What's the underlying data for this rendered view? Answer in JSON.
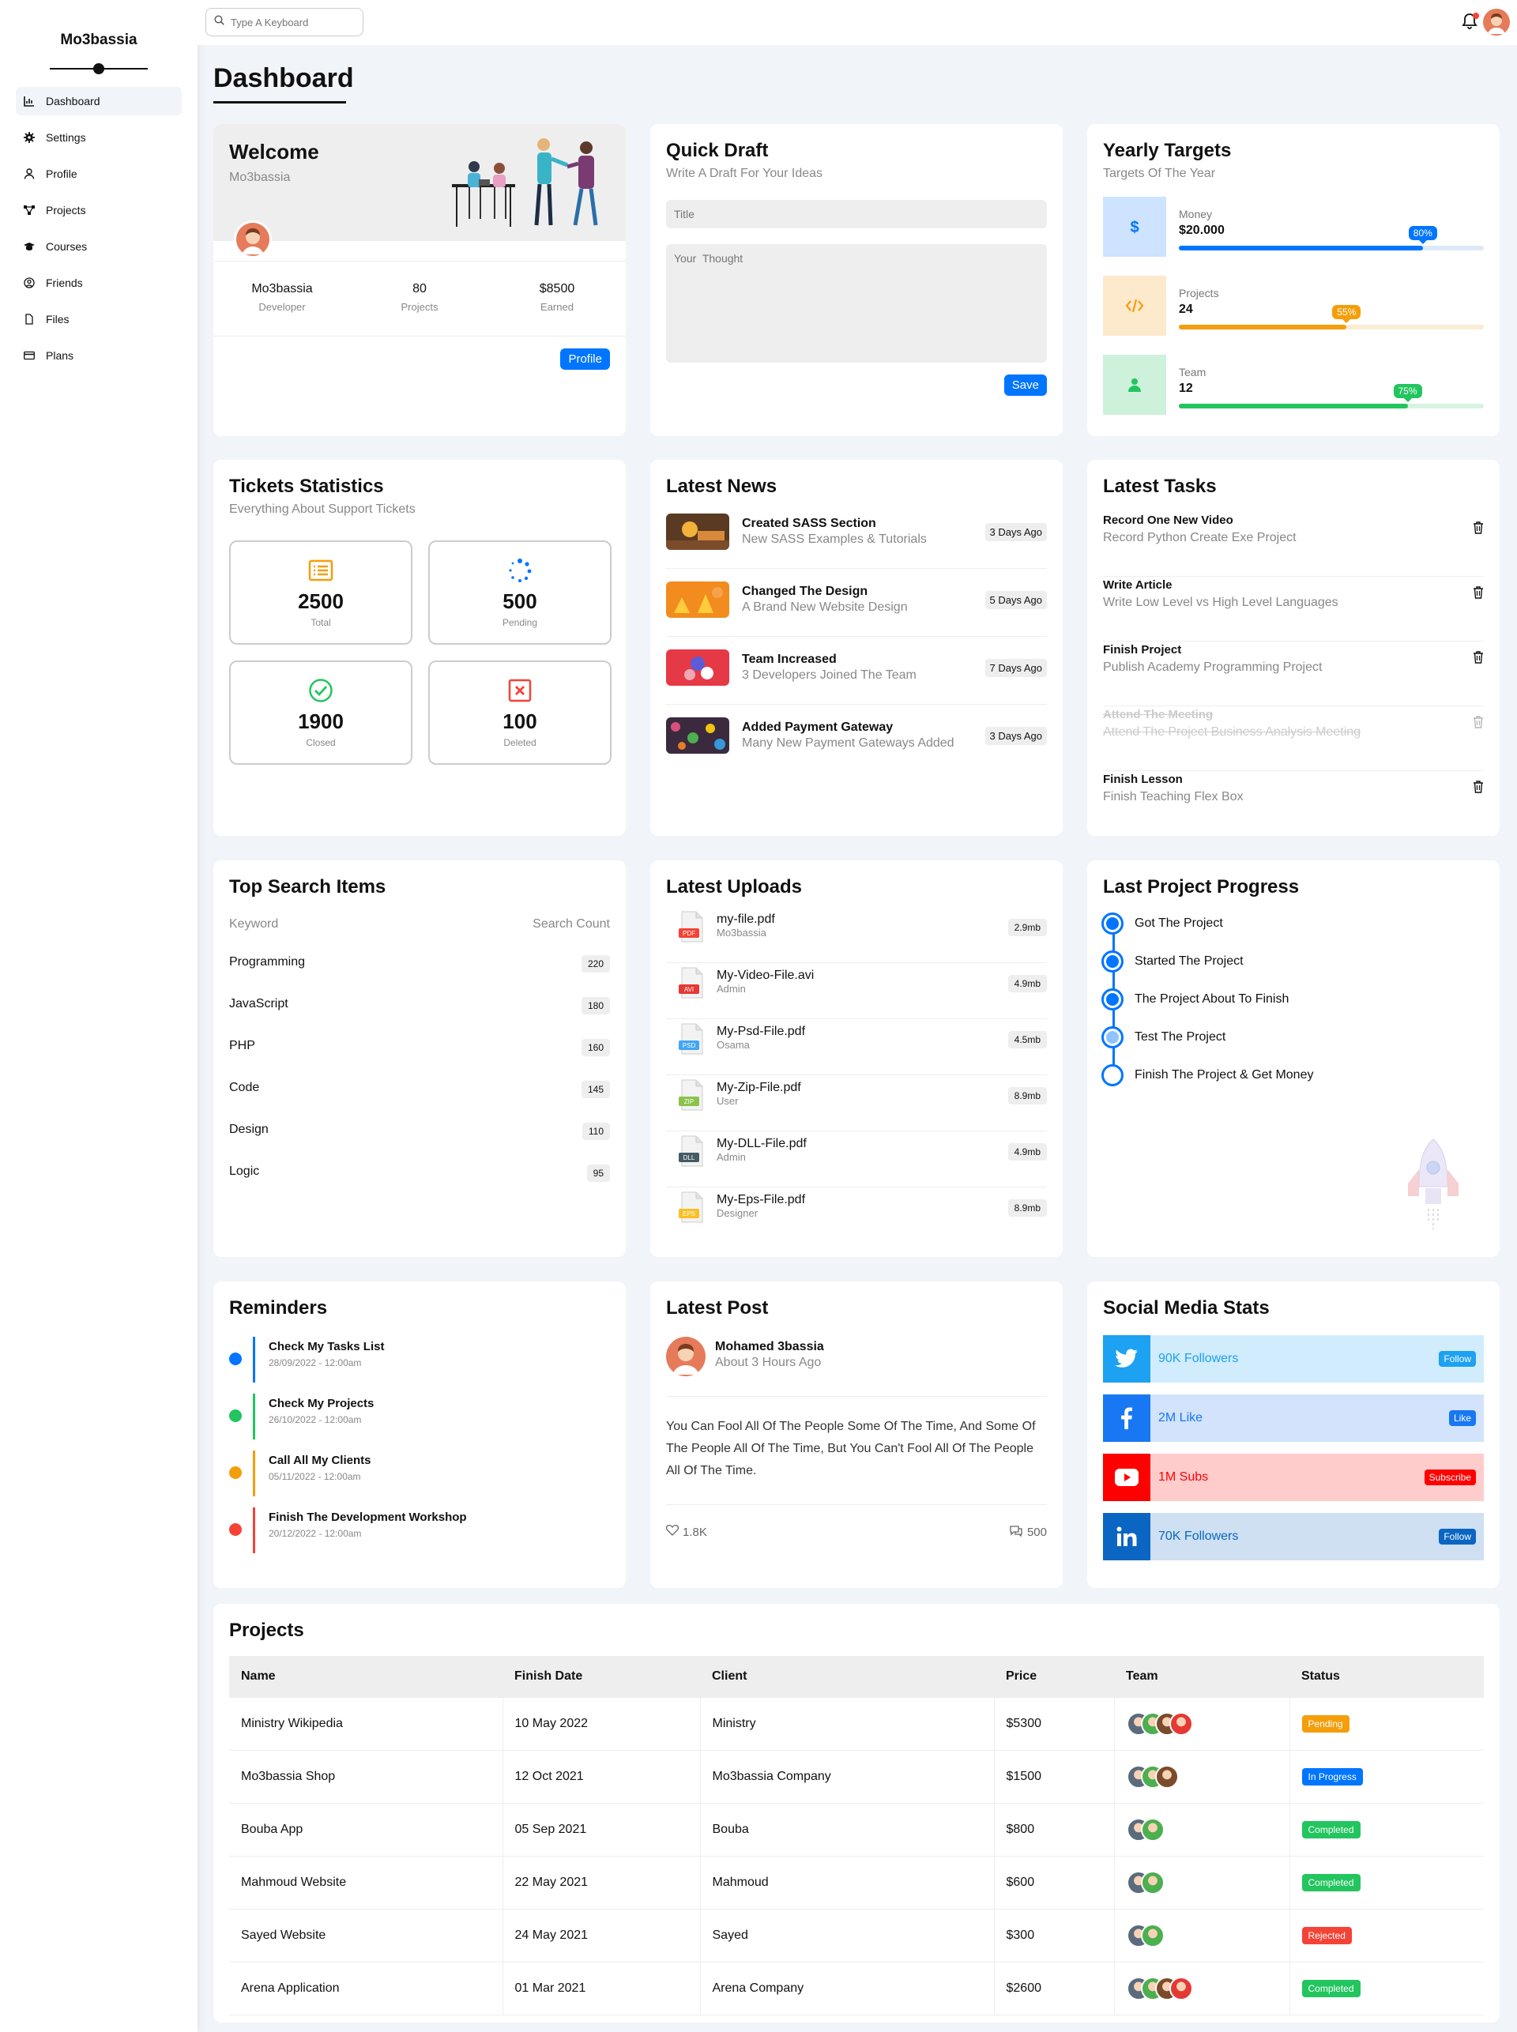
{
  "brand": "Mo3bassia",
  "sidebar": {
    "items": [
      {
        "label": "Dashboard",
        "icon": "chart-icon"
      },
      {
        "label": "Settings",
        "icon": "gear-icon"
      },
      {
        "label": "Profile",
        "icon": "user-icon"
      },
      {
        "label": "Projects",
        "icon": "diagram-icon"
      },
      {
        "label": "Courses",
        "icon": "graduation-cap-icon"
      },
      {
        "label": "Friends",
        "icon": "user-circle-icon"
      },
      {
        "label": "Files",
        "icon": "file-icon"
      },
      {
        "label": "Plans",
        "icon": "credit-card-icon"
      }
    ]
  },
  "header": {
    "search_placeholder": "Type A Keyboard"
  },
  "page_title": "Dashboard",
  "welcome": {
    "title": "Welcome",
    "subtitle": "Mo3bassia",
    "stats": [
      {
        "value": "Mo3bassia",
        "label": "Developer"
      },
      {
        "value": "80",
        "label": "Projects"
      },
      {
        "value": "$8500",
        "label": "Earned"
      }
    ],
    "button": "Profile"
  },
  "draft": {
    "title": "Quick Draft",
    "subtitle": "Write A Draft For Your Ideas",
    "title_placeholder": "Title",
    "thought_placeholder": "Your  Thought",
    "button": "Save"
  },
  "targets": {
    "title": "Yearly Targets",
    "subtitle": "Targets Of The Year",
    "items": [
      {
        "label": "Money",
        "value": "$20.000",
        "percent": 80,
        "badge": "80%",
        "icon": "dollar-icon",
        "color": "#0075ff",
        "bg": "#cde3ff",
        "track": "#dde9f8"
      },
      {
        "label": "Projects",
        "value": "24",
        "percent": 55,
        "badge": "55%",
        "icon": "code-icon",
        "color": "#f59e0b",
        "bg": "#fde9cc",
        "track": "#fbecd6"
      },
      {
        "label": "Team",
        "value": "12",
        "percent": 75,
        "badge": "75%",
        "icon": "user-icon",
        "color": "#22c55e",
        "bg": "#cdf1da",
        "track": "#d9f3e2"
      }
    ]
  },
  "tickets": {
    "title": "Tickets Statistics",
    "subtitle": "Everything About Support Tickets",
    "items": [
      {
        "value": "2500",
        "label": "Total",
        "icon": "list-icon",
        "color": "#f59e0b"
      },
      {
        "value": "500",
        "label": "Pending",
        "icon": "spinner-icon",
        "color": "#0075ff"
      },
      {
        "value": "1900",
        "label": "Closed",
        "icon": "check-circle-icon",
        "color": "#22c55e"
      },
      {
        "value": "100",
        "label": "Deleted",
        "icon": "x-square-icon",
        "color": "#f44336"
      }
    ]
  },
  "news": {
    "title": "Latest News",
    "items": [
      {
        "title": "Created SASS Section",
        "desc": "New SASS Examples & Tutorials",
        "date": "3 Days Ago"
      },
      {
        "title": "Changed The Design",
        "desc": "A Brand New Website Design",
        "date": "5 Days Ago"
      },
      {
        "title": "Team Increased",
        "desc": "3 Developers Joined The Team",
        "date": "7 Days Ago"
      },
      {
        "title": "Added Payment Gateway",
        "desc": "Many New Payment Gateways Added",
        "date": "3 Days Ago"
      }
    ]
  },
  "tasks": {
    "title": "Latest Tasks",
    "items": [
      {
        "title": "Record One New Video",
        "desc": "Record Python Create Exe Project",
        "done": false
      },
      {
        "title": "Write Article",
        "desc": "Write Low Level vs High Level Languages",
        "done": false
      },
      {
        "title": "Finish Project",
        "desc": "Publish Academy Programming Project",
        "done": false
      },
      {
        "title": "Attend The Meeting",
        "desc": "Attend The Project Business Analysis Meeting",
        "done": true
      },
      {
        "title": "Finish Lesson",
        "desc": "Finish Teaching Flex Box",
        "done": false
      }
    ]
  },
  "search_items": {
    "title": "Top Search Items",
    "col_keyword": "Keyword",
    "col_count": "Search Count",
    "items": [
      {
        "keyword": "Programming",
        "count": "220"
      },
      {
        "keyword": "JavaScript",
        "count": "180"
      },
      {
        "keyword": "PHP",
        "count": "160"
      },
      {
        "keyword": "Code",
        "count": "145"
      },
      {
        "keyword": "Design",
        "count": "110"
      },
      {
        "keyword": "Logic",
        "count": "95"
      }
    ]
  },
  "uploads": {
    "title": "Latest Uploads",
    "items": [
      {
        "name": "my-file.pdf",
        "user": "Mo3bassia",
        "size": "2.9mb",
        "ext": "PDF",
        "color": "#f44336"
      },
      {
        "name": "My-Video-File.avi",
        "user": "Admin",
        "size": "4.9mb",
        "ext": "AVI",
        "color": "#e53935"
      },
      {
        "name": "My-Psd-File.pdf",
        "user": "Osama",
        "size": "4.5mb",
        "ext": "PSD",
        "color": "#42a5f5"
      },
      {
        "name": "My-Zip-File.pdf",
        "user": "User",
        "size": "8.9mb",
        "ext": "ZIP",
        "color": "#8bc34a"
      },
      {
        "name": "My-DLL-File.pdf",
        "user": "Admin",
        "size": "4.9mb",
        "ext": "DLL",
        "color": "#455a64"
      },
      {
        "name": "My-Eps-File.pdf",
        "user": "Designer",
        "size": "8.9mb",
        "ext": "EPS",
        "color": "#fbbf24"
      }
    ]
  },
  "progress": {
    "title": "Last Project Progress",
    "items": [
      {
        "label": "Got The Project",
        "state": "done"
      },
      {
        "label": "Started The Project",
        "state": "done"
      },
      {
        "label": "The Project About To Finish",
        "state": "done"
      },
      {
        "label": "Test The Project",
        "state": "current"
      },
      {
        "label": "Finish The Project & Get Money",
        "state": "todo"
      }
    ]
  },
  "reminders": {
    "title": "Reminders",
    "items": [
      {
        "title": "Check My Tasks List",
        "date": "28/09/2022 - 12:00am",
        "color": "#0075ff"
      },
      {
        "title": "Check My Projects",
        "date": "26/10/2022 - 12:00am",
        "color": "#22c55e"
      },
      {
        "title": "Call All My Clients",
        "date": "05/11/2022 - 12:00am",
        "color": "#f59e0b"
      },
      {
        "title": "Finish The Development Workshop",
        "date": "20/12/2022 - 12:00am",
        "color": "#f44336"
      }
    ]
  },
  "post": {
    "title": "Latest Post",
    "author": "Mohamed 3bassia",
    "time": "About 3 Hours Ago",
    "body": "You Can Fool All Of The People Some Of The Time, And Some Of The People All Of The Time, But You Can't Fool All Of The People All Of The Time.",
    "likes": "1.8K",
    "comments": "500"
  },
  "social": {
    "title": "Social Media Stats",
    "items": [
      {
        "text": "90K Followers",
        "button": "Follow",
        "icon": "twitter-icon",
        "color": "#1da1f2",
        "bg": "#d1ecfc"
      },
      {
        "text": "2M Like",
        "button": "Like",
        "icon": "facebook-icon",
        "color": "#1877f2",
        "bg": "#d2e3fb"
      },
      {
        "text": "1M Subs",
        "button": "Subscribe",
        "icon": "youtube-icon",
        "color": "#ff0000",
        "bg": "#ffcccc"
      },
      {
        "text": "70K Followers",
        "button": "Follow",
        "icon": "linkedin-icon",
        "color": "#0a66c2",
        "bg": "#cee0f2"
      }
    ]
  },
  "projects": {
    "title": "Projects",
    "columns": [
      "Name",
      "Finish Date",
      "Client",
      "Price",
      "Team",
      "Status"
    ],
    "rows": [
      {
        "name": "Ministry Wikipedia",
        "date": "10 May 2022",
        "client": "Ministry",
        "price": "$5300",
        "team": 4,
        "status": "Pending",
        "status_color": "#f59e0b"
      },
      {
        "name": "Mo3bassia Shop",
        "date": "12 Oct 2021",
        "client": "Mo3bassia Company",
        "price": "$1500",
        "team": 3,
        "status": "In Progress",
        "status_color": "#0075ff"
      },
      {
        "name": "Bouba App",
        "date": "05 Sep 2021",
        "client": "Bouba",
        "price": "$800",
        "team": 2,
        "status": "Completed",
        "status_color": "#22c55e"
      },
      {
        "name": "Mahmoud Website",
        "date": "22 May 2021",
        "client": "Mahmoud",
        "price": "$600",
        "team": 2,
        "status": "Completed",
        "status_color": "#22c55e"
      },
      {
        "name": "Sayed Website",
        "date": "24 May 2021",
        "client": "Sayed",
        "price": "$300",
        "team": 2,
        "status": "Rejected",
        "status_color": "#f44336"
      },
      {
        "name": "Arena Application",
        "date": "01 Mar 2021",
        "client": "Arena Company",
        "price": "$2600",
        "team": 4,
        "status": "Completed",
        "status_color": "#22c55e"
      }
    ]
  }
}
